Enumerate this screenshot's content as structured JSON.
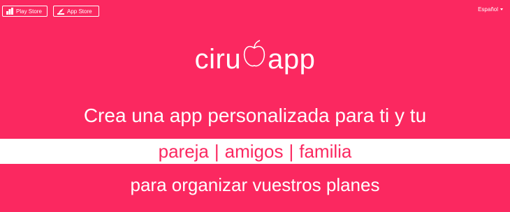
{
  "header": {
    "play_store_label": "Play Store",
    "app_store_label": "App Store",
    "language_label": "Español"
  },
  "logo": {
    "text_before": "ciru",
    "text_after": "app"
  },
  "hero": {
    "headline": "Crea una app personalizada para ti y tu",
    "audiences": [
      "pareja",
      "amigos",
      "familia"
    ],
    "separator": "|",
    "tagline": "para organizar vuestros planes"
  },
  "colors": {
    "background": "#FB2860",
    "band": "#FFFFFF"
  }
}
